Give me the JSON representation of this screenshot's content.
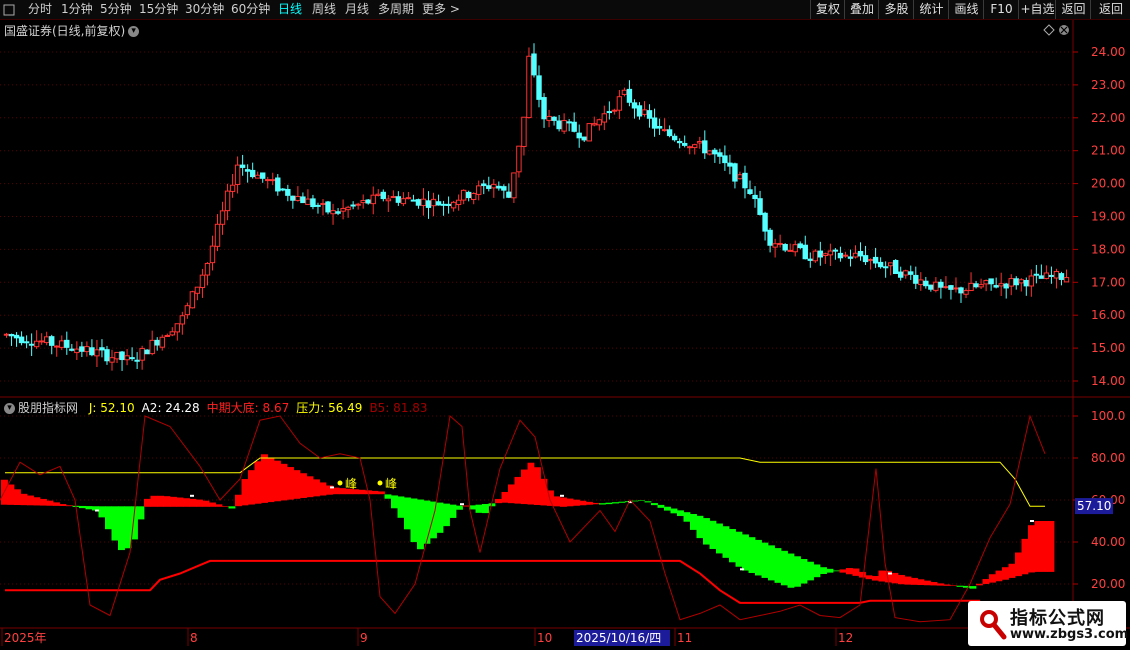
{
  "toolbar": {
    "periods": [
      "分时",
      "1分钟",
      "5分钟",
      "15分钟",
      "30分钟",
      "60分钟",
      "日线",
      "周线",
      "月线",
      "多周期"
    ],
    "active_period": "日线",
    "more_label": "更多 >",
    "right_buttons": [
      "复权",
      "叠加",
      "多股",
      "统计",
      "画线",
      "F10",
      "+自选",
      "返回"
    ],
    "left_icon": "square-icon"
  },
  "kline": {
    "title": "国盛证券(日线,前复权)",
    "price_ticks": [
      "24.00",
      "23.00",
      "22.00",
      "21.00",
      "20.00",
      "19.00",
      "18.00",
      "17.00",
      "16.00",
      "15.00",
      "14.00"
    ],
    "price_tick_values": [
      24,
      23,
      22,
      21,
      20,
      19,
      18,
      17,
      16,
      15,
      14
    ]
  },
  "indicator": {
    "name": "股朋指标网",
    "values": [
      {
        "label": "J: 52.10",
        "color": "#ffff00"
      },
      {
        "label": "A2: 24.28",
        "color": "#ffffff"
      },
      {
        "label": "中期大底: 8.67",
        "color": "#ff2020"
      },
      {
        "label": "压力: 56.49",
        "color": "#ffff00"
      },
      {
        "label": "B5: 81.83",
        "color": "#a00000"
      }
    ],
    "ticks": [
      "100.0",
      "80.00",
      "60.00",
      "40.00",
      "20.00"
    ],
    "tick_values": [
      100,
      80,
      60,
      40,
      20
    ],
    "current_value": "57.10",
    "peak_label": "峰"
  },
  "date_axis": {
    "labels": [
      "2025年",
      "8",
      "9",
      "10",
      "11",
      "12"
    ],
    "highlight": "2025/10/16/四"
  },
  "watermark": {
    "title": "指标公式网",
    "url": "www.zbgs3.com"
  },
  "colors": {
    "up": "#ff3232",
    "down": "#54ffff",
    "grid": "#5a0000",
    "red": "#ff0000",
    "green": "#00ff00",
    "yellow": "#ffff00"
  }
}
